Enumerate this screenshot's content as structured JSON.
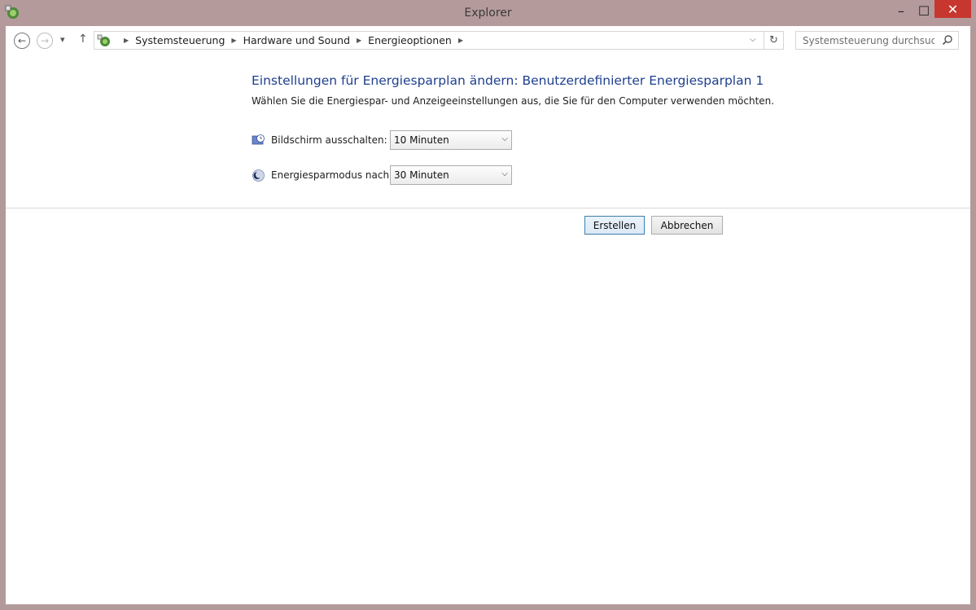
{
  "window": {
    "title": "Explorer",
    "minimize_label": "–",
    "maximize_label": "☐",
    "close_label": "✕"
  },
  "nav": {
    "back_glyph": "←",
    "forward_glyph": "→",
    "recent_glyph": "▾",
    "up_glyph": "↑",
    "dropdown_glyph": "⌵",
    "refresh_glyph": "↻"
  },
  "breadcrumb": {
    "items": [
      "Systemsteuerung",
      "Hardware und Sound",
      "Energieoptionen"
    ]
  },
  "search": {
    "placeholder": "Systemsteuerung durchsuchen"
  },
  "main": {
    "heading": "Einstellungen für Energiesparplan ändern: Benutzerdefinierter Energiesparplan 1",
    "subheading": "Wählen Sie die Energiespar- und Anzeigeeinstellungen aus, die Sie für den Computer verwenden möchten.",
    "settings": [
      {
        "label": "Bildschirm ausschalten:",
        "value": "10 Minuten",
        "icon": "display-off-icon"
      },
      {
        "label": "Energiesparmodus nach:",
        "value": "30 Minuten",
        "icon": "sleep-moon-icon"
      }
    ],
    "create_label": "Erstellen",
    "cancel_label": "Abbrechen"
  },
  "colors": {
    "titlebar": "#b59a9b",
    "heading": "#1e3f8f",
    "close": "#c7372f"
  }
}
